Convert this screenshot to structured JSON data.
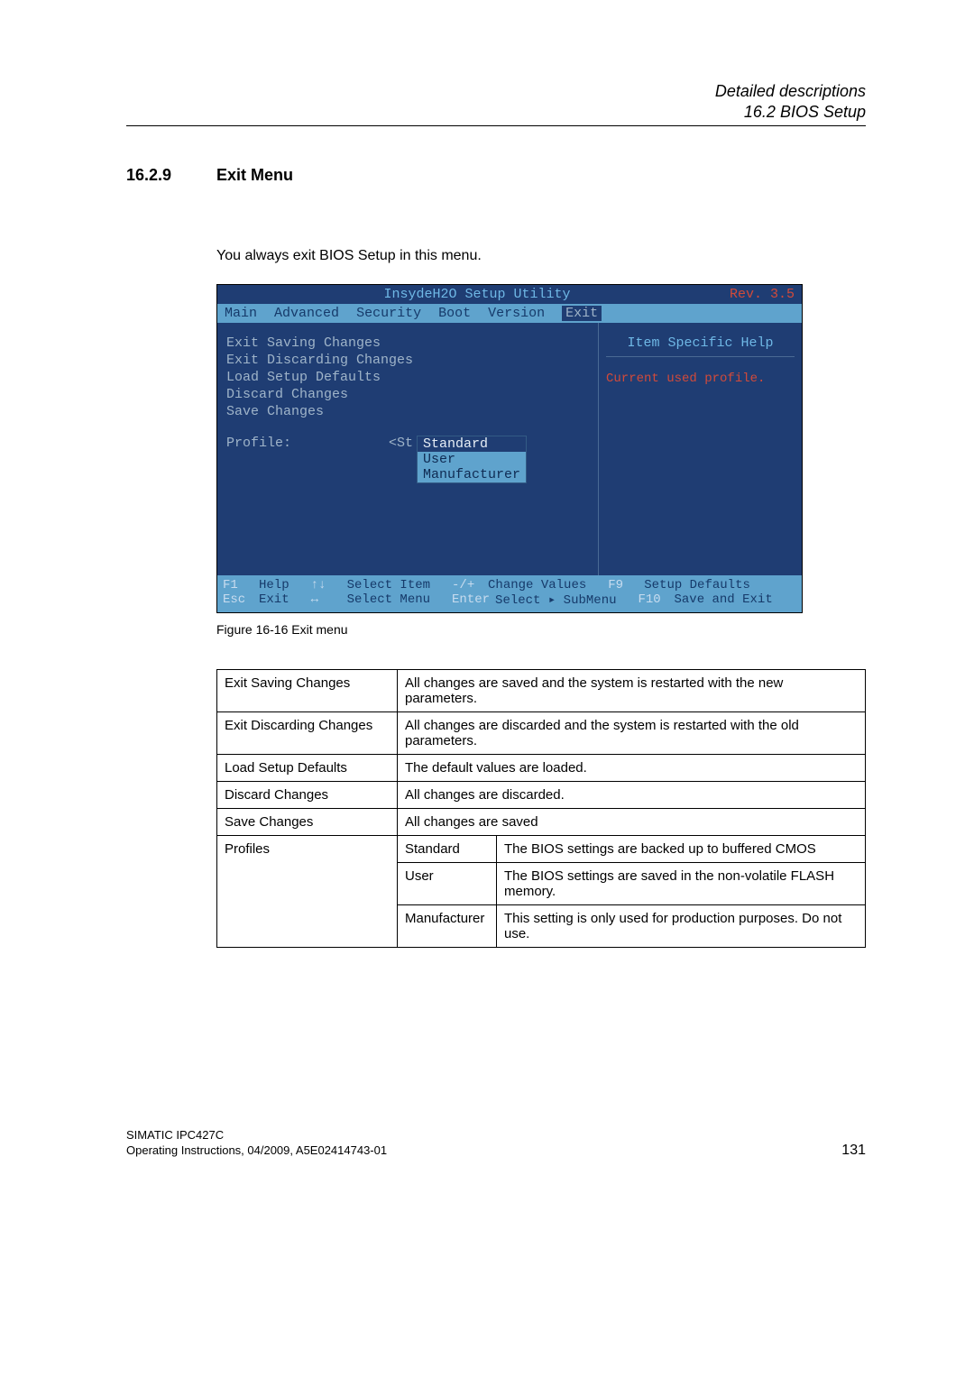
{
  "header": {
    "line1": "Detailed descriptions",
    "line2": "16.2 BIOS Setup"
  },
  "section": {
    "number": "16.2.9",
    "title": "Exit Menu"
  },
  "intro": "You always exit BIOS Setup in this menu.",
  "bios": {
    "title": "InsydeH2O Setup Utility",
    "rev": "Rev. 3.5",
    "tabs": {
      "main": "Main",
      "advanced": "Advanced",
      "security": "Security",
      "boot": "Boot",
      "version": "Version",
      "exit": "Exit"
    },
    "menu": {
      "i0": "Exit Saving Changes",
      "i1": "Exit Discarding Changes",
      "i2": "Load Setup Defaults",
      "i3": "Discard Changes",
      "i4": "Save Changes",
      "profile_label": "Profile:",
      "profile_prefix": "<St"
    },
    "popup": {
      "o0": "Standard",
      "o1": "User",
      "o2": "Manufacturer"
    },
    "help": {
      "title": "Item Specific Help",
      "text": "Current used profile."
    },
    "footer": {
      "k_f1": "F1",
      "l_help": "Help",
      "k_ud": "↑↓",
      "l_selitem": "Select Item",
      "k_pm": "-/+",
      "l_change": "Change Values",
      "k_f9": "F9",
      "l_defaults": "Setup Defaults",
      "k_esc": "Esc",
      "l_exit": "Exit",
      "k_lr": "↔",
      "l_selmenu": "Select Menu",
      "k_enter": "Enter",
      "l_submenu": "Select ▸ SubMenu",
      "k_f10": "F10",
      "l_save": "Save and Exit"
    }
  },
  "figure_caption": "Figure 16-16  Exit menu",
  "table": {
    "r0c0": "Exit Saving Changes",
    "r0c1": "All changes are saved and the system is restarted with the new parameters.",
    "r1c0": "Exit Discarding Changes",
    "r1c1": "All changes are discarded and the system is restarted with the old parameters.",
    "r2c0": "Load Setup Defaults",
    "r2c1": "The default values are loaded.",
    "r3c0": "Discard Changes",
    "r3c1": "All changes are discarded.",
    "r4c0": "Save Changes",
    "r4c1": "All changes are saved",
    "r5c0": "Profiles",
    "r5c1a": "Standard",
    "r5c1b": "The BIOS settings are backed up to buffered CMOS",
    "r6c1a": "User",
    "r6c1b": "The BIOS settings are saved in the non-volatile FLASH memory.",
    "r7c1a": "Manufacturer",
    "r7c1b": "This setting is only used for production purposes. Do not use."
  },
  "footer": {
    "line1": "SIMATIC IPC427C",
    "line2": "Operating Instructions, 04/2009, A5E02414743-01",
    "pagenum": "131"
  }
}
